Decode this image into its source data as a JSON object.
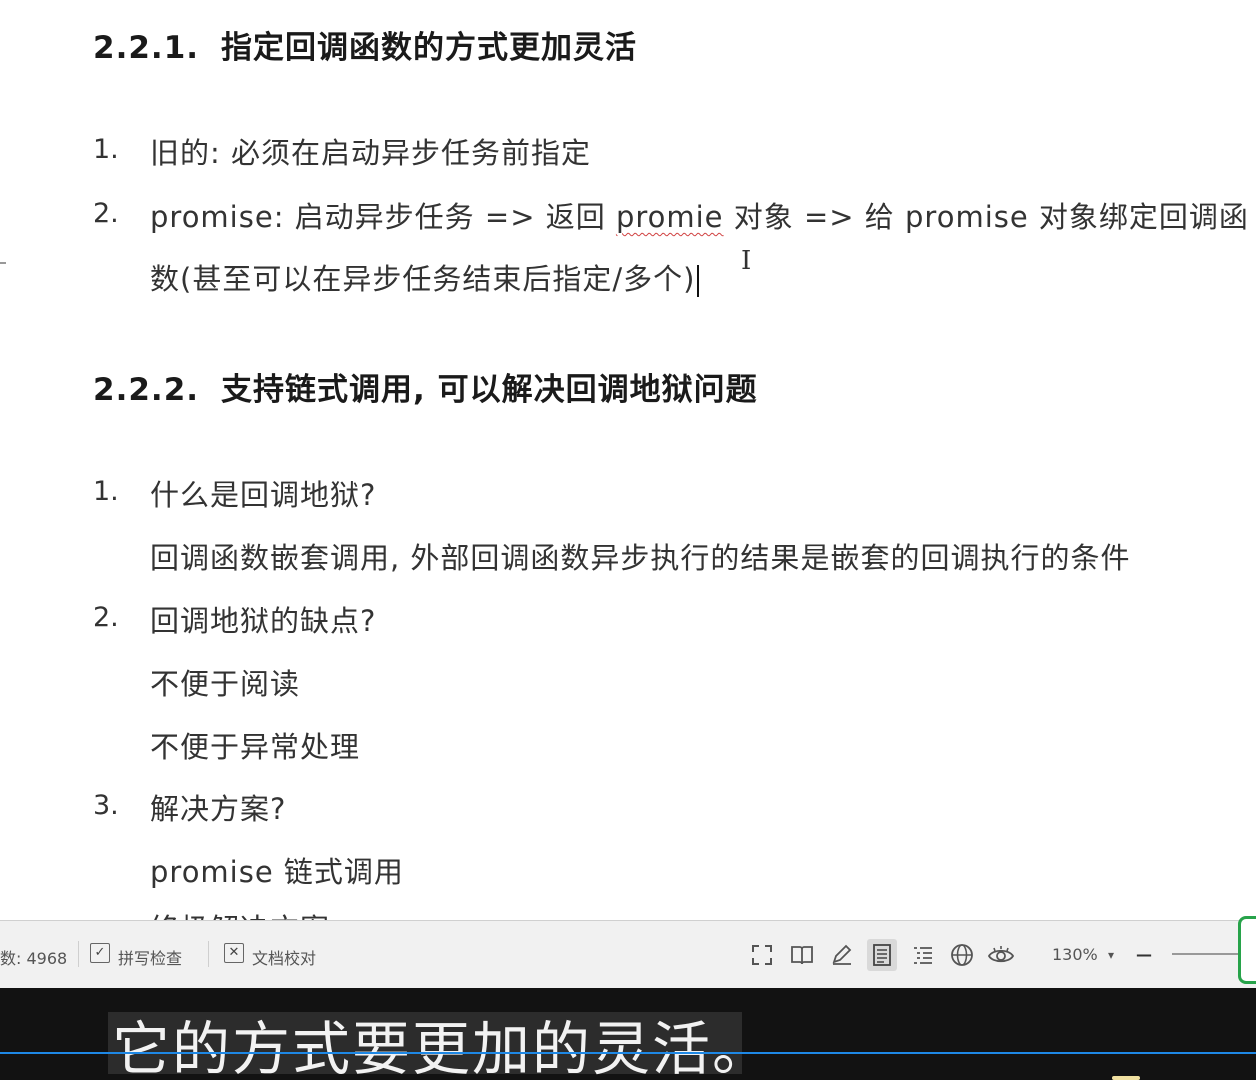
{
  "document": {
    "sections": [
      {
        "num": "2.2.1.",
        "title": "指定回调函数的方式更加灵活",
        "items": [
          {
            "num": "1.",
            "text": "旧的: 必须在启动异步任务前指定"
          },
          {
            "num": "2.",
            "text_a": "promise: 启动异步任务 => 返回 ",
            "text_squiggle": "promie",
            "text_b": " 对象 => 给 promise 对象绑定回调函",
            "text_cont": "数(甚至可以在异步任务结束后指定/多个)"
          }
        ]
      },
      {
        "num": "2.2.2.",
        "title": "支持链式调用, 可以解决回调地狱问题",
        "items": [
          {
            "num": "1.",
            "text": "什么是回调地狱?",
            "sub": [
              "回调函数嵌套调用, 外部回调函数异步执行的结果是嵌套的回调执行的条件"
            ]
          },
          {
            "num": "2.",
            "text": "回调地狱的缺点?",
            "sub": [
              "不便于阅读",
              "不便于异常处理"
            ]
          },
          {
            "num": "3.",
            "text": "解决方案?",
            "sub": [
              "promise 链式调用",
              "终极解决方案"
            ]
          }
        ]
      }
    ]
  },
  "status_bar": {
    "word_count": "数: 4968",
    "spell_check": "拼写检查",
    "doc_proof": "文档校对",
    "zoom": "130%",
    "zoom_dropdown": "▾",
    "zoom_out": "—"
  },
  "subtitle": {
    "text": "它的方式要更加的灵活。"
  },
  "icons": {
    "fullscreen": "fullscreen-icon",
    "read_mode": "book-icon",
    "edit": "pen-icon",
    "page_view": "page-view-icon",
    "outline": "outline-icon",
    "web": "globe-icon",
    "eye": "eye-protection-icon"
  },
  "colors": {
    "accent_green": "#27a34a",
    "subtitle_line": "#1e88e5",
    "spell_error": "#d04040"
  }
}
